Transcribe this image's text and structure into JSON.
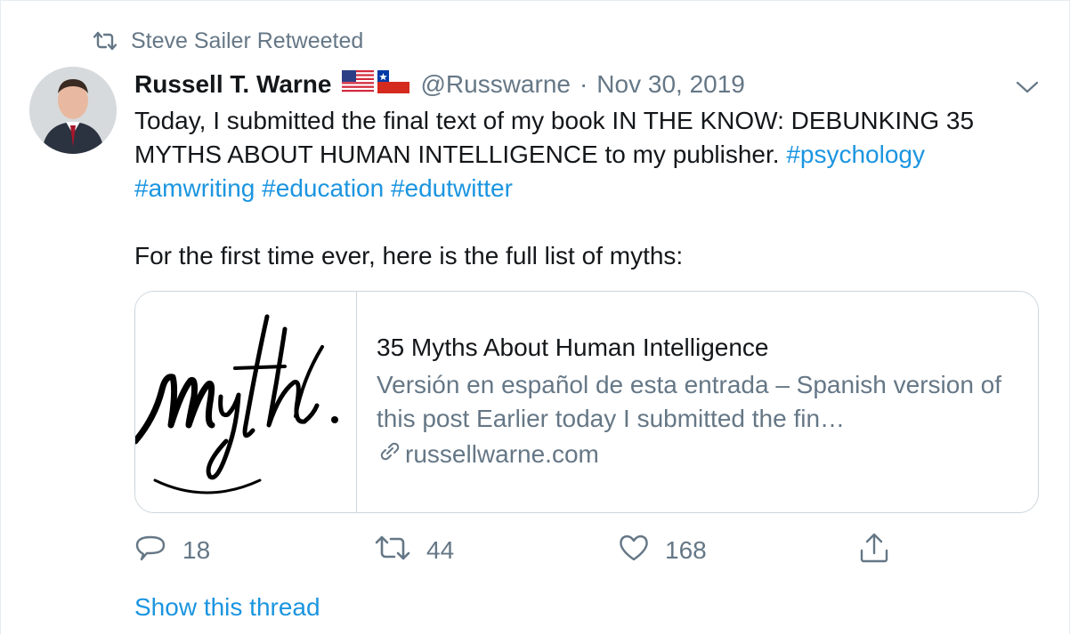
{
  "retweet": {
    "icon": "retweet-icon",
    "label": "Steve Sailer Retweeted"
  },
  "author": {
    "name": "Russell T. Warne",
    "flags": [
      "us-flag-icon",
      "chile-flag-icon"
    ],
    "handle": "@Russwarne",
    "separator": "·",
    "date": "Nov 30, 2019"
  },
  "tweet": {
    "text_part1": "Today, I submitted the final text of my book IN THE KNOW: DEBUNKING 35 MYTHS ABOUT HUMAN INTELLIGENCE to my publisher. ",
    "hashtags_line1": [
      "#psychology"
    ],
    "hashtags_line2": [
      "#amwriting",
      "#education",
      "#edutwitter"
    ],
    "text_part2": "For the first time ever, here is the full list of myths:"
  },
  "card": {
    "image_alt": "Myth",
    "title": "35 Myths About Human Intelligence",
    "description": "Versión en español de esta entrada – Spanish version of this post Earlier today I submitted the fin…",
    "domain": "russellwarne.com"
  },
  "actions": {
    "reply_count": "18",
    "retweet_count": "44",
    "like_count": "168"
  },
  "show_thread": "Show this thread",
  "colors": {
    "link": "#1b95e0",
    "secondary_text": "#657786",
    "border": "#ccd6dd"
  }
}
